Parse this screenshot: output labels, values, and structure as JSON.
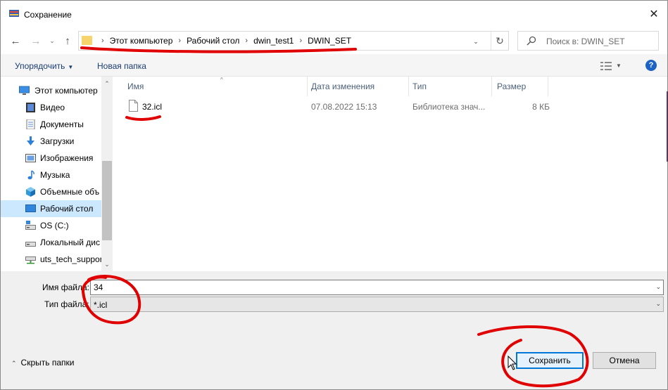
{
  "window": {
    "title": "Сохранение",
    "close_glyph": "✕"
  },
  "nav": {
    "back_glyph": "←",
    "forward_glyph": "→",
    "recent_glyph": "⌄",
    "up_glyph": "↑"
  },
  "address": {
    "crumbs": [
      "Этот компьютер",
      "Рабочий стол",
      "dwin_test1",
      "DWIN_SET"
    ],
    "separator": "›",
    "dropdown_glyph": "⌄",
    "refresh_glyph": "↻"
  },
  "search": {
    "placeholder": "Поиск в: DWIN_SET"
  },
  "toolbar": {
    "organize_label": "Упорядочить",
    "caret": "▼",
    "new_folder_label": "Новая папка",
    "help_label": "?"
  },
  "sidebar": {
    "items": [
      {
        "label": "Этот компьютер",
        "icon": "computer-icon"
      },
      {
        "label": "Видео",
        "icon": "video-icon"
      },
      {
        "label": "Документы",
        "icon": "documents-icon"
      },
      {
        "label": "Загрузки",
        "icon": "downloads-icon"
      },
      {
        "label": "Изображения",
        "icon": "pictures-icon"
      },
      {
        "label": "Музыка",
        "icon": "music-icon"
      },
      {
        "label": "Объемные объ",
        "icon": "3d-objects-icon"
      },
      {
        "label": "Рабочий стол",
        "icon": "desktop-icon",
        "selected": true
      },
      {
        "label": "OS (C:)",
        "icon": "drive-icon"
      },
      {
        "label": "Локальный дис",
        "icon": "drive-icon"
      },
      {
        "label": "uts_tech_suppor",
        "icon": "network-drive-icon"
      }
    ],
    "scroll_up_glyph": "⌃",
    "scroll_down_glyph": "⌄"
  },
  "files": {
    "columns": {
      "name": "Имя",
      "date": "Дата изменения",
      "type": "Тип",
      "size": "Размер"
    },
    "sort_glyph": "^",
    "rows": [
      {
        "name": "32.icl",
        "date": "07.08.2022 15:13",
        "type": "Библиотека знач...",
        "size": "8 КБ"
      }
    ]
  },
  "form": {
    "filename_label": "Имя файла:",
    "filename_value": "34",
    "filetype_label": "Тип файла:",
    "filetype_value": "*.icl",
    "drop_glyph": "⌄"
  },
  "footer": {
    "hide_folders_label": "Скрыть папки",
    "hide_caret": "⌃",
    "save_label": "Сохранить",
    "cancel_label": "Отмена"
  },
  "colors": {
    "accent": "#0078d7",
    "selected_bg": "#cce8ff",
    "annotation_red": "#e00000",
    "folder_yellow": "#f6d36b"
  }
}
